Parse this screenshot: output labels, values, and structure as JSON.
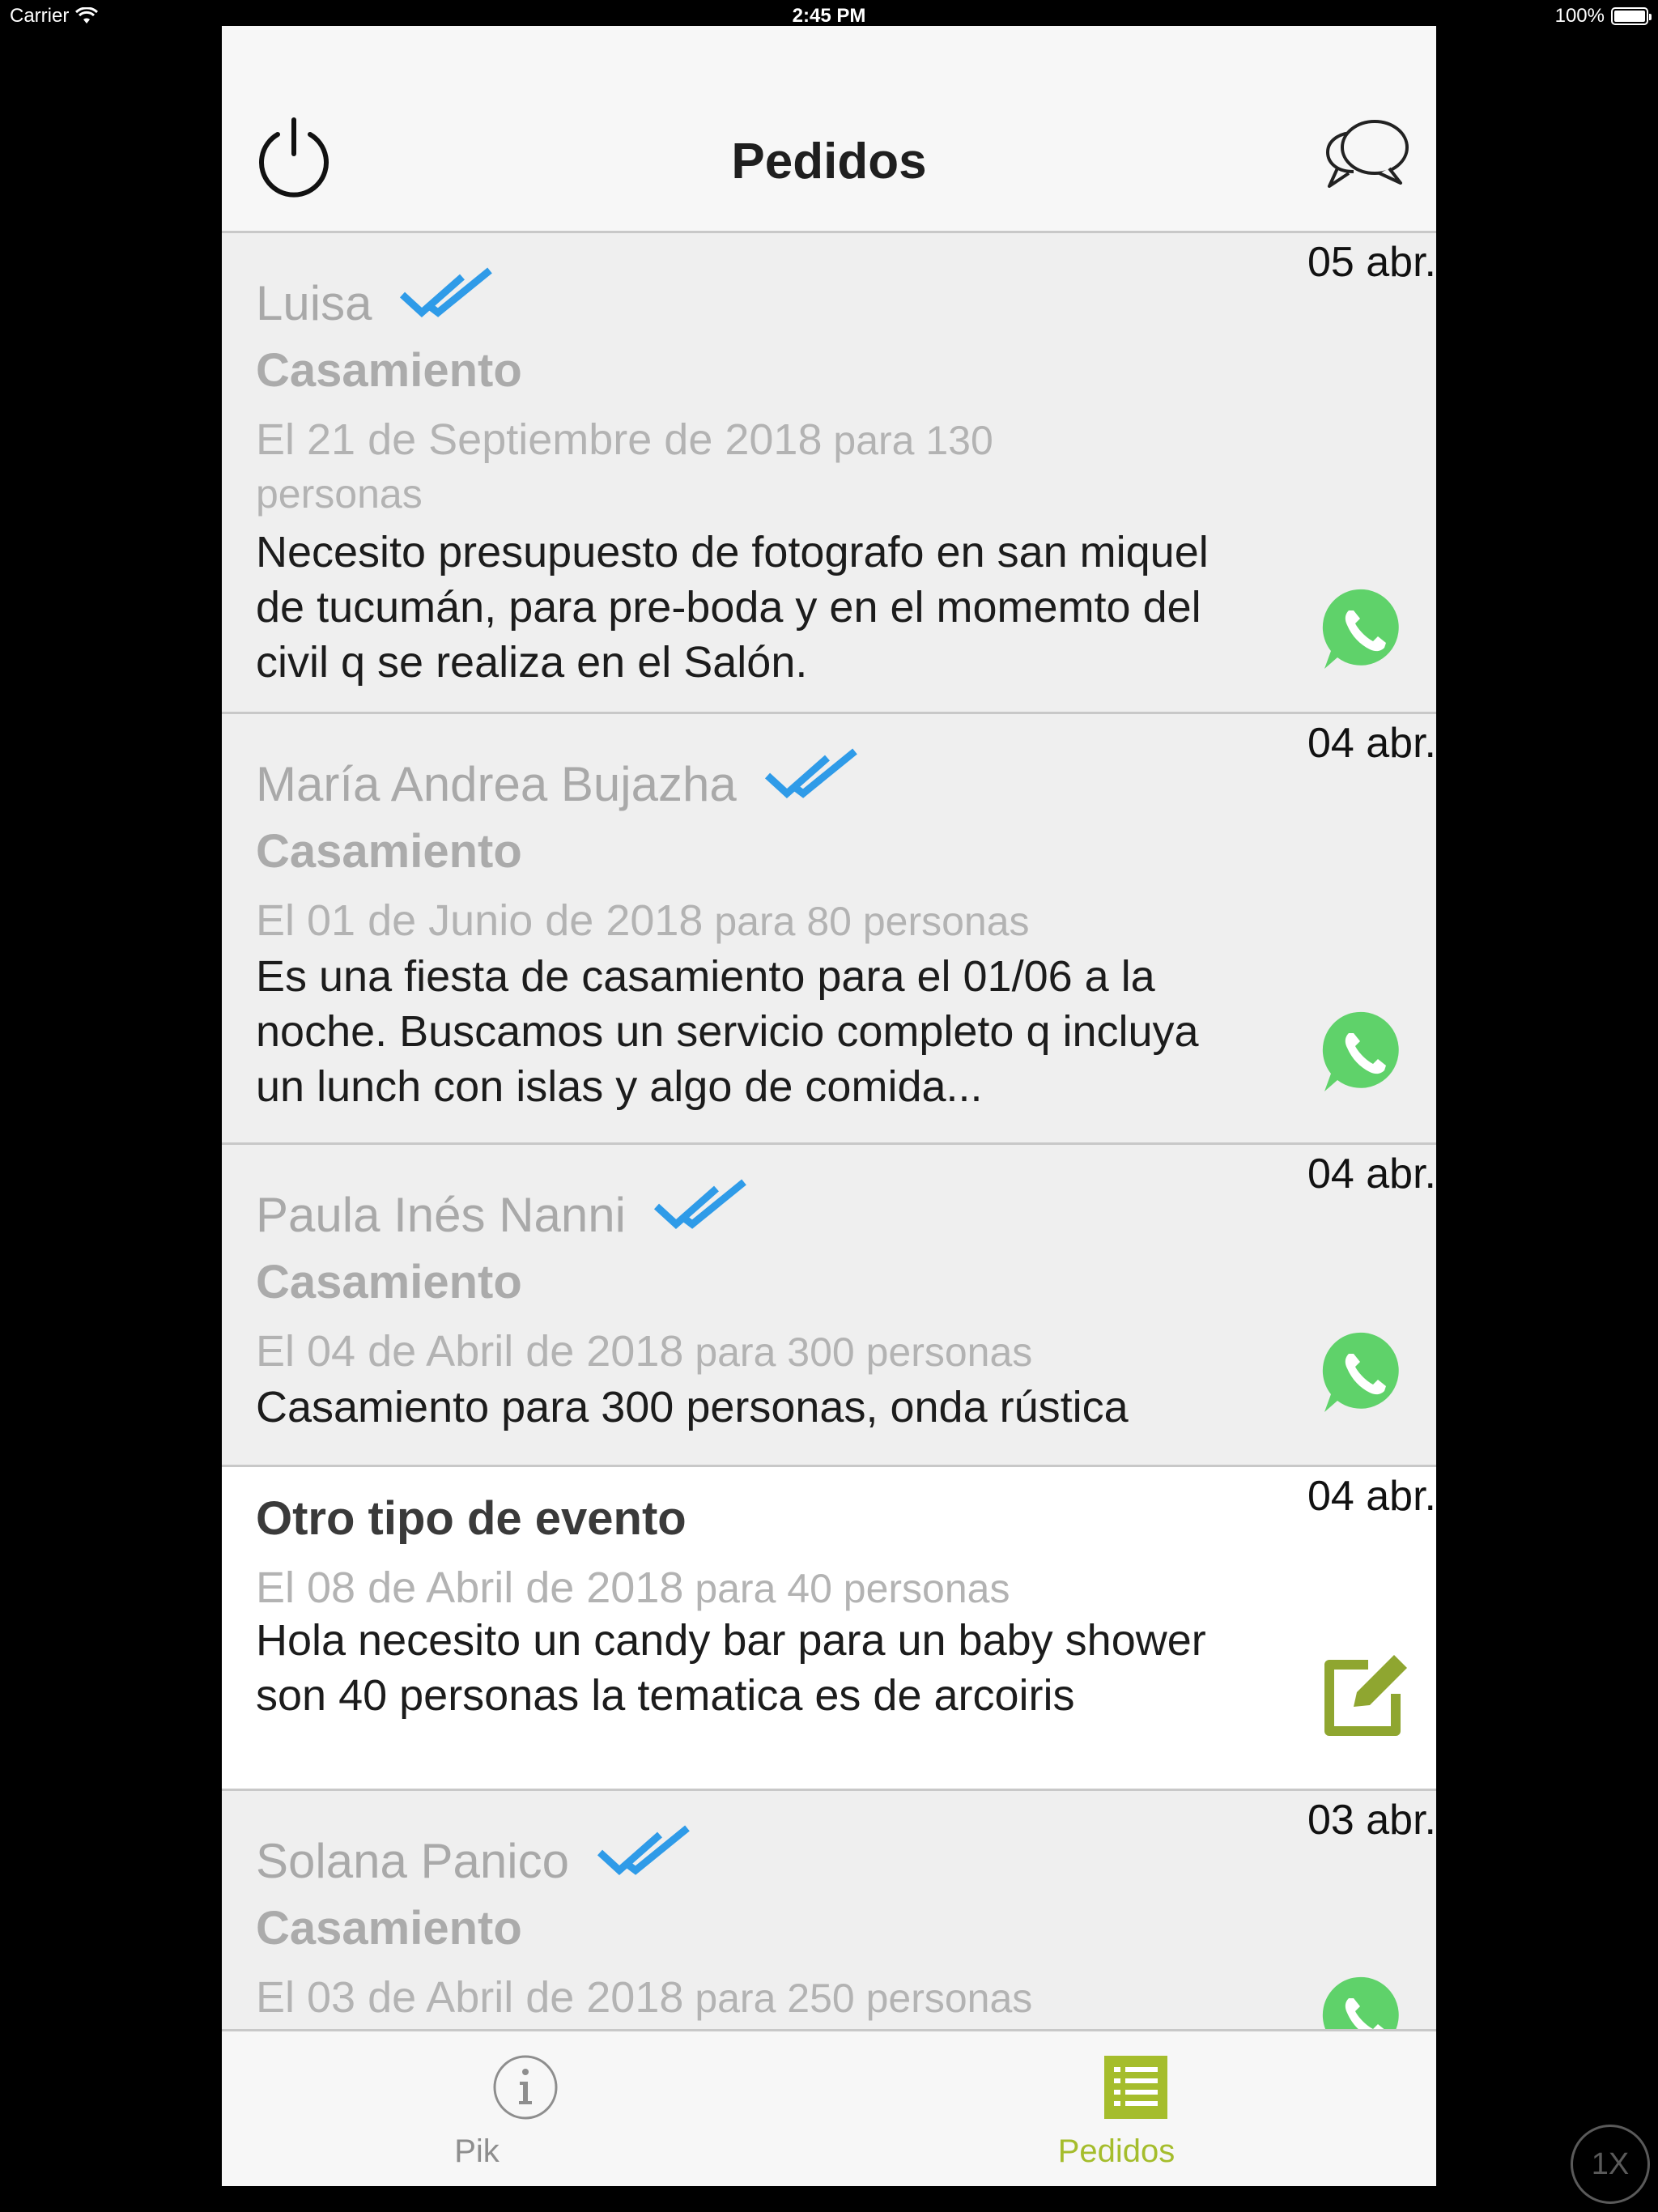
{
  "status_bar": {
    "carrier": "Carrier",
    "time": "2:45 PM",
    "battery": "100%"
  },
  "nav": {
    "title": "Pedidos"
  },
  "orders": [
    {
      "name": "Luisa",
      "event": "Casamiento",
      "date_text": "El 21 de Septiembre de 2018",
      "guests_text": "para 130 personas",
      "message": "Necesito presupuesto de fotografo en san miquel de tucumán, para pre-boda y en el momemto del civil q se realiza en el Salón.",
      "stamp": "05 abr.",
      "read": true,
      "action_icon": "whatsapp-icon"
    },
    {
      "name": "María Andrea Bujazha",
      "event": "Casamiento",
      "date_text": "El 01 de Junio de 2018",
      "guests_text": "para 80 personas",
      "message": "Es una fiesta de casamiento para el 01/06 a la noche. Buscamos un servicio completo q incluya un lunch con islas y algo de comida...",
      "stamp": "04 abr.",
      "read": true,
      "action_icon": "whatsapp-icon"
    },
    {
      "name": "Paula Inés Nanni",
      "event": "Casamiento",
      "date_text": "El 04 de Abril de 2018",
      "guests_text": "para 300 personas",
      "message": "Casamiento para 300 personas, onda rústica",
      "stamp": "04 abr.",
      "read": true,
      "action_icon": "whatsapp-icon"
    },
    {
      "name": "",
      "event": "Otro tipo de evento",
      "date_text": "El 08 de Abril de 2018",
      "guests_text": "para 40 personas",
      "message": "Hola necesito un candy bar para un baby shower  son 40 personas  la tematica es de arcoiris",
      "stamp": "04 abr.",
      "read": false,
      "action_icon": "edit-icon"
    },
    {
      "name": "Solana Panico",
      "event": "Casamiento",
      "date_text": "El 03 de Abril de 2018",
      "guests_text": "para 250 personas",
      "message": "",
      "stamp": "03 abr.",
      "read": true,
      "action_icon": "whatsapp-icon"
    }
  ],
  "tabs": [
    {
      "label": "Pik",
      "icon": "info-icon",
      "selected": false
    },
    {
      "label": "Pedidos",
      "icon": "list-icon",
      "selected": true
    }
  ],
  "zoom": "1X",
  "colors": {
    "accent": "#a5bd2c",
    "whatsapp": "#5fd26a",
    "read_ticks": "#2f9be8",
    "row_read_bg": "#efefef",
    "row_unread_bg": "#ffffff"
  }
}
